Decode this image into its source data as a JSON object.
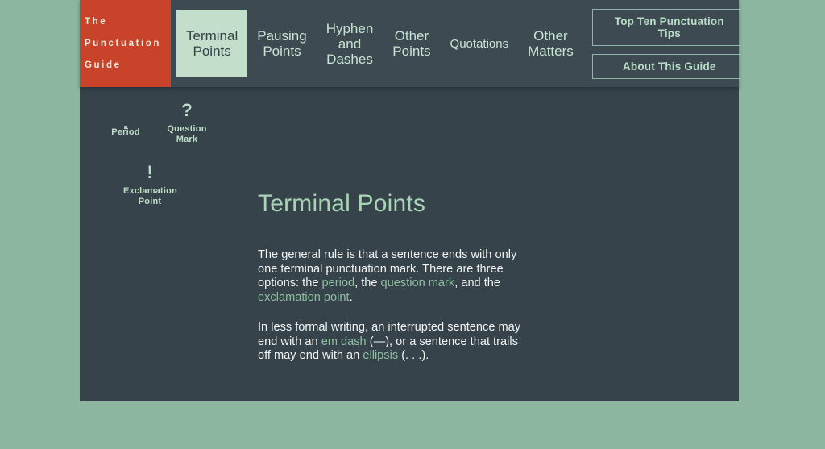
{
  "colors": {
    "page_background": "#8cb6a0",
    "header_background": "#3d4a52",
    "panel_background": "#36434b",
    "logo_background": "#c8432a",
    "accent_mint": "#c3dfcb",
    "link_green": "#8fbfa0",
    "heading_green": "#a9d4b6"
  },
  "logo": {
    "line1": "The",
    "line2": "Punctuation",
    "line3": "Guide"
  },
  "nav": {
    "items": [
      {
        "label": "Terminal\nPoints",
        "active": true
      },
      {
        "label": "Pausing\nPoints",
        "active": false
      },
      {
        "label": "Hyphen\nand\nDashes",
        "active": false
      },
      {
        "label": "Other\nPoints",
        "active": false
      },
      {
        "label": "Quotations",
        "active": false
      },
      {
        "label": "Other\nMatters",
        "active": false
      }
    ]
  },
  "header_buttons": {
    "tips": "Top Ten Punctuation Tips",
    "about": "About This Guide"
  },
  "marks": [
    {
      "glyph": ".",
      "label": "Period",
      "name": "period"
    },
    {
      "glyph": "?",
      "label": "Question\nMark",
      "name": "question-mark"
    },
    {
      "glyph": "!",
      "label": "Exclamation\nPoint",
      "name": "exclamation-point"
    }
  ],
  "main": {
    "title": "Terminal Points",
    "paragraph1": {
      "seg1": "The general rule is that a sentence ends with only one terminal punctuation mark. There are three options: the ",
      "link1": "period",
      "seg2": ", the ",
      "link2": "question mark",
      "seg3": ", and the ",
      "link3": "exclamation point",
      "seg4": "."
    },
    "paragraph2": {
      "seg1": "In less formal writing, an interrupted sentence may end with an ",
      "link1": "em dash",
      "seg2": " (—), or a sentence that trails off may end with an ",
      "link2": "ellipsis",
      "seg3": " (. . .)."
    }
  }
}
